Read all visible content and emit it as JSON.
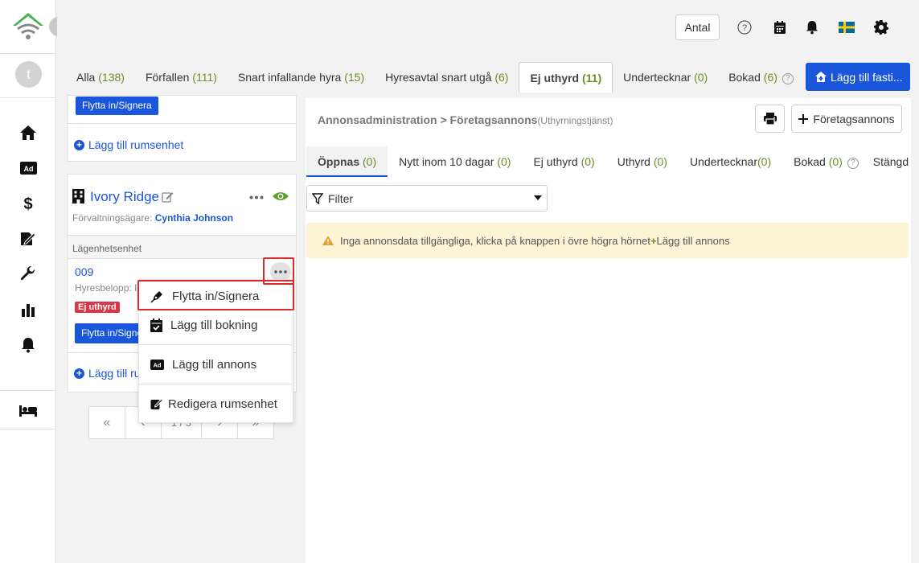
{
  "header": {
    "antal_label": "Antal"
  },
  "sidebar": {
    "avatar_initial": "t",
    "items": [
      {
        "name": "home"
      },
      {
        "name": "ads"
      },
      {
        "name": "finance"
      },
      {
        "name": "contracts"
      },
      {
        "name": "maintenance"
      },
      {
        "name": "statistics"
      },
      {
        "name": "notifications"
      },
      {
        "name": "bed"
      }
    ]
  },
  "tabs": [
    {
      "label": "Alla",
      "count": "(138)"
    },
    {
      "label": "Förfallen",
      "count": "(111)"
    },
    {
      "label": "Snart infallande hyra",
      "count": "(15)"
    },
    {
      "label": "Hyresavtal snart utgå",
      "count": "(6)"
    },
    {
      "label": "Ej uthyrd",
      "count": "(11)"
    },
    {
      "label": "Undertecknar",
      "count": "(0)"
    },
    {
      "label": "Bokad",
      "count": "(6)"
    }
  ],
  "add_property_label": "Lägg till fasti...",
  "left": {
    "top_card": {
      "move_in_label": "Flytta in/Signera",
      "add_room_label": "Lägg till rumsenhet"
    },
    "property": {
      "name": "Ivory Ridge",
      "owner_label": "Förvaltningsägare:",
      "owner_name": "Cynthia Johnson",
      "section_label": "Lägenhetsenhet",
      "unit_number": "009",
      "rent_label": "Hyresbelopp: I",
      "status_badge": "Ej uthyrd",
      "move_in_label": "Flytta in/Signe",
      "add_room_label": "Lägg till ru"
    },
    "pagination": {
      "first": "«",
      "prev": "‹",
      "page": "1 / 3",
      "next": "›",
      "last": "»"
    }
  },
  "menu": {
    "items": [
      {
        "label": "Flytta in/Signera",
        "icon": "pen-icon"
      },
      {
        "label": "Lägg till bokning",
        "icon": "calendar-check-icon"
      },
      {
        "label": "Lägg till annons",
        "icon": "ad-icon"
      },
      {
        "label": "Redigera rumsenhet",
        "icon": "edit-icon"
      }
    ]
  },
  "main": {
    "breadcrumb_root": "Annonsadministration",
    "breadcrumb_sep": ">",
    "breadcrumb_current": "Företagsannons",
    "breadcrumb_sub": "(Uthyrningstjänst)",
    "ad_button_label": "Företagsannons",
    "subtabs": [
      {
        "label": "Öppnas",
        "count": "(0)"
      },
      {
        "label": "Nytt inom 10 dagar",
        "count": "(0)"
      },
      {
        "label": "Ej uthyrd",
        "count": "(0)"
      },
      {
        "label": "Uthyrd",
        "count": "(0)"
      },
      {
        "label": "Undertecknar",
        "count": "(0)"
      },
      {
        "label": "Bokad",
        "count": "(0)"
      },
      {
        "label": "Stängd",
        "count": ""
      }
    ],
    "filter_label": "Filter",
    "alert_text": "Inga annonsdata tillgängliga, klicka på knappen i övre högra hörnet",
    "alert_link": "Lägg till annons"
  },
  "colors": {
    "accent": "#1a56db",
    "count_green": "#6b8e23",
    "brand_green": "#4caf50",
    "eye_green": "#5a9e2f",
    "highlight_red": "#d92b2b",
    "badge_red": "#dc3545",
    "alert_bg": "#fdf3d5"
  }
}
